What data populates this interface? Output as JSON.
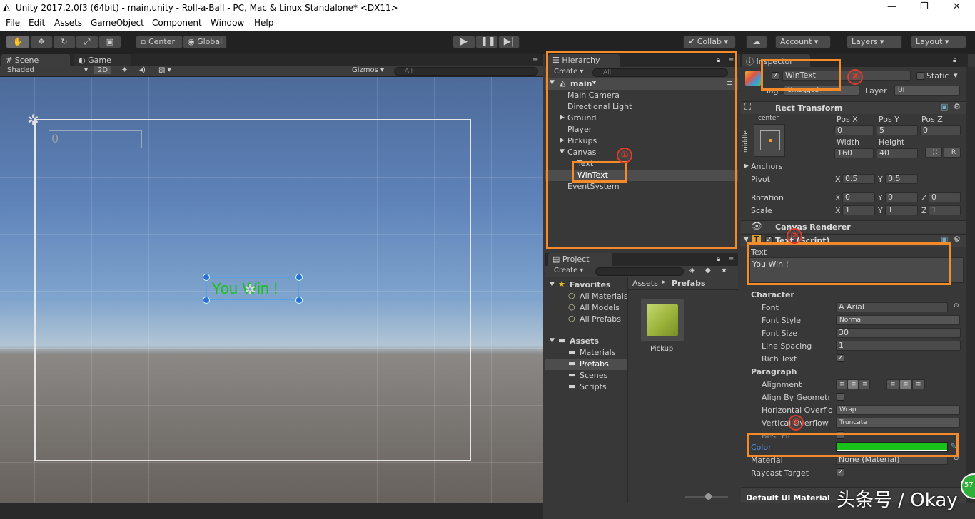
{
  "window": {
    "title": "Unity 2017.2.0f3 (64bit) - main.unity - Roll-a-Ball - PC, Mac & Linux Standalone* <DX11>",
    "minimize_icon": "minimize-icon",
    "restore_icon": "restore-icon",
    "close_icon": "close-icon"
  },
  "menu": [
    "File",
    "Edit",
    "Assets",
    "GameObject",
    "Component",
    "Window",
    "Help"
  ],
  "toolbar": {
    "center": "Center",
    "global": "Global",
    "collab": "Collab",
    "account": "Account",
    "layers": "Layers",
    "layout": "Layout"
  },
  "scene_tabs": {
    "scene": "Scene",
    "game": "Game",
    "shaded": "Shaded",
    "twod": "2D",
    "gizmos": "Gizmos",
    "search_placeholder": "All"
  },
  "scene_view": {
    "score_text": "0",
    "win_text": "You Win !",
    "win_color": "#19c219"
  },
  "hierarchy": {
    "tab": "Hierarchy",
    "create": "Create",
    "search_placeholder": "All",
    "scene_name": "main*",
    "items": [
      {
        "label": "Main Camera"
      },
      {
        "label": "Directional Light"
      },
      {
        "label": "Ground"
      },
      {
        "label": "Player"
      },
      {
        "label": "Pickups"
      },
      {
        "label": "Canvas"
      },
      {
        "label": "Text"
      },
      {
        "label": "WinText"
      },
      {
        "label": "EventSystem"
      }
    ]
  },
  "project": {
    "tab": "Project",
    "create": "Create",
    "favorites": "Favorites",
    "fav_items": [
      "All Materials",
      "All Models",
      "All Prefabs"
    ],
    "assets": "Assets",
    "asset_folders": [
      "Materials",
      "Prefabs",
      "Scenes",
      "Scripts"
    ],
    "breadcrumb_root": "Assets",
    "breadcrumb_sep": "▸",
    "breadcrumb_leaf": "Prefabs",
    "prefab_name": "Pickup"
  },
  "inspector": {
    "tab": "Inspector",
    "object_name": "WinText",
    "static_label": "Static",
    "tag_label": "Tag",
    "tag_value": "Untagged",
    "layer_label": "Layer",
    "layer_value": "UI",
    "rect_transform": {
      "title": "Rect Transform",
      "anchor_h": "center",
      "anchor_v": "middle",
      "pos_x_label": "Pos X",
      "pos_y_label": "Pos Y",
      "pos_z_label": "Pos Z",
      "pos_x": "0",
      "pos_y": "5",
      "pos_z": "0",
      "width_label": "Width",
      "height_label": "Height",
      "width": "160",
      "height": "40",
      "r_button": "R",
      "anchors": "Anchors",
      "pivot": "Pivot",
      "pivot_x_label": "X",
      "pivot_y_label": "Y",
      "pivot_x": "0.5",
      "pivot_y": "0.5",
      "rotation": "Rotation",
      "rot_x": "0",
      "rot_y": "0",
      "rot_z": "0",
      "scale": "Scale",
      "scale_x": "1",
      "scale_y": "1",
      "scale_z": "1",
      "x_label": "X",
      "y_label": "Y",
      "z_label": "Z"
    },
    "canvas_renderer": "Canvas Renderer",
    "text_script": {
      "title": "Text (Script)",
      "text_label": "Text",
      "text_value": "You Win !",
      "character": "Character",
      "font_label": "Font",
      "font_value": "Arial",
      "font_style_label": "Font Style",
      "font_style_value": "Normal",
      "font_size_label": "Font Size",
      "font_size_value": "30",
      "line_spacing_label": "Line Spacing",
      "line_spacing_value": "1",
      "rich_text_label": "Rich Text",
      "paragraph": "Paragraph",
      "alignment_label": "Alignment",
      "align_by_geometry_label": "Align By Geometr",
      "horizontal_overflow_label": "Horizontal Overflo",
      "horizontal_overflow_value": "Wrap",
      "vertical_overflow_label": "Vertical Overflow",
      "vertical_overflow_value": "Truncate",
      "best_fit_label": "Best Fit",
      "color_label": "Color",
      "color_value": "#19c219",
      "material_label": "Material",
      "material_value": "None (Material)",
      "raycast_label": "Raycast Target"
    },
    "footer": "Default UI Material"
  },
  "annotations": [
    "①",
    "②",
    "③",
    "④"
  ],
  "watermark": "头条号 / Okay",
  "badge": "57"
}
